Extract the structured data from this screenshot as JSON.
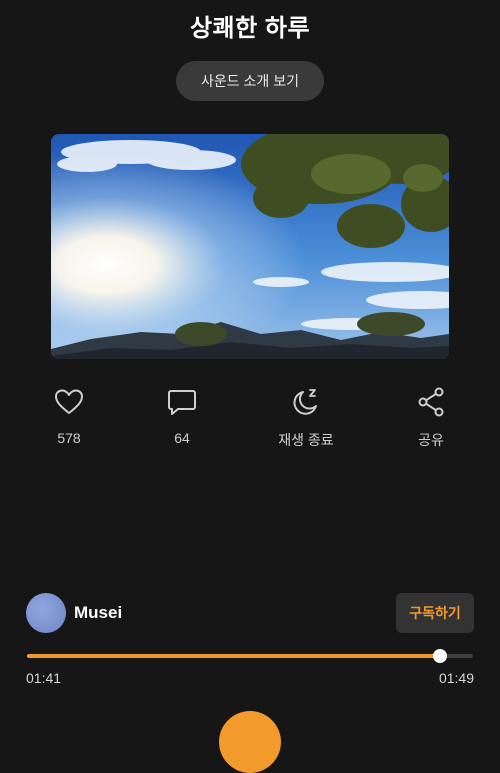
{
  "header": {
    "title": "상쾌한 하루"
  },
  "intro": {
    "label": "사운드 소개 보기"
  },
  "actions": {
    "like": {
      "count": "578",
      "icon": "heart-icon"
    },
    "comment": {
      "count": "64",
      "icon": "comment-icon"
    },
    "sleep_timer": {
      "label": "재생 종료",
      "icon": "moon-icon"
    },
    "share": {
      "label": "공유",
      "icon": "share-icon"
    }
  },
  "author": {
    "name": "Musei"
  },
  "subscribe": {
    "label": "구독하기"
  },
  "player": {
    "current_time": "01:41",
    "total_time": "01:49",
    "progress": 0.925
  },
  "colors": {
    "accent": "#f39a2c",
    "background": "#161616",
    "button": "#3a3a3a"
  }
}
